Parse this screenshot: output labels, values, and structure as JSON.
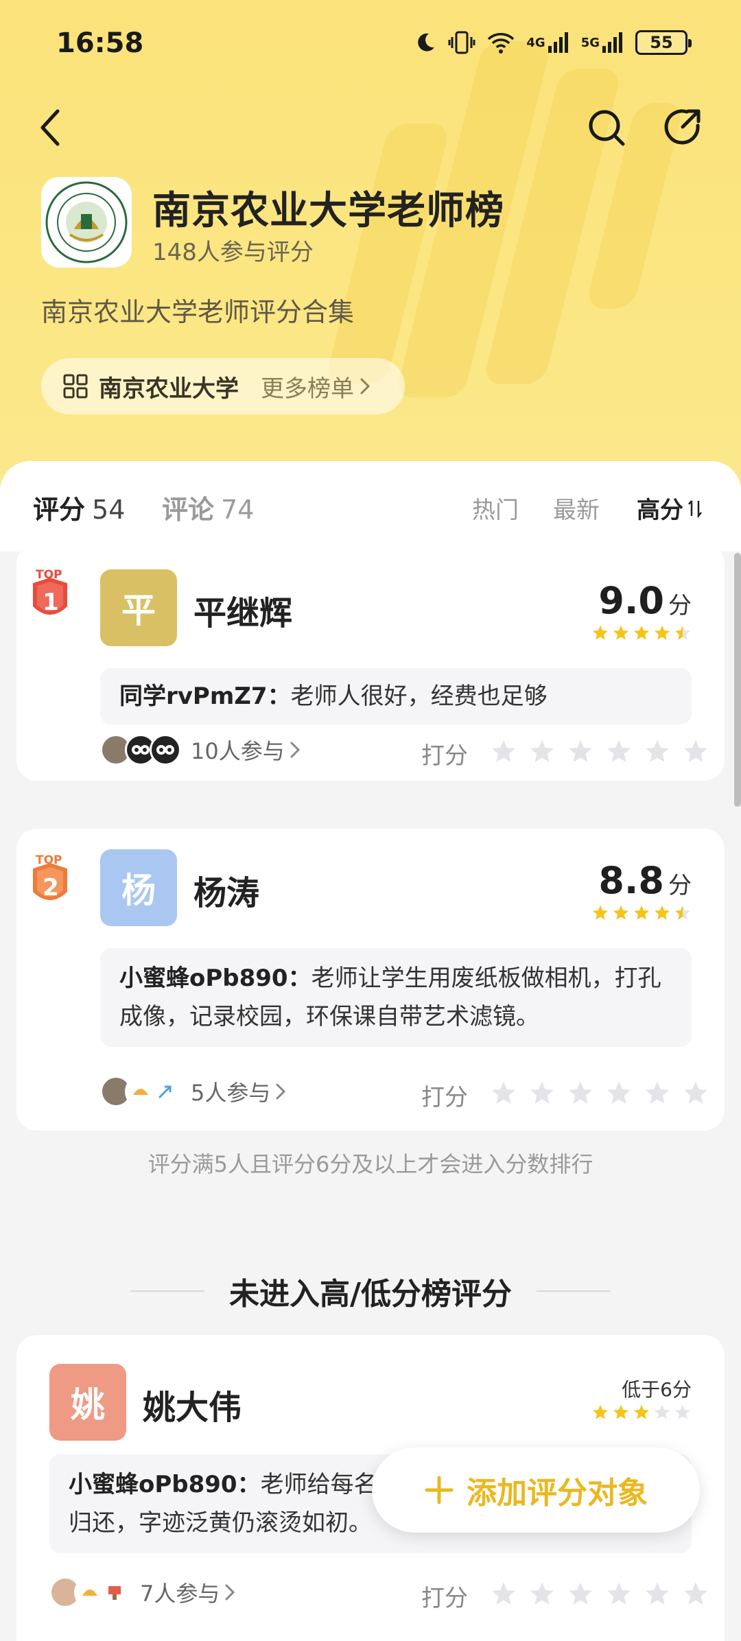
{
  "status_bar": {
    "time": "16:58",
    "network_a": "4G",
    "network_b": "5G",
    "battery": "55"
  },
  "header": {
    "title": "南京农业大学老师榜",
    "participants": "148人参与评分",
    "description": "南京农业大学老师评分合集",
    "school_name": "南京农业大学",
    "more_lists": "更多榜单"
  },
  "tabs": {
    "score_label": "评分",
    "score_count": "54",
    "comment_label": "评论",
    "comment_count": "74",
    "sort_hot": "热门",
    "sort_new": "最新",
    "sort_high": "高分"
  },
  "ranked": [
    {
      "rank": "1",
      "top_label": "TOP",
      "avatar_char": "平",
      "name": "平继辉",
      "score": "9.0",
      "score_unit": "分",
      "stars": 4.5,
      "comment_user": "同学rvPmZ7：",
      "comment_text": "老师人很好，经费也足够",
      "participants": "10人参与",
      "rate_label": "打分",
      "avatar_color": "#d9c064"
    },
    {
      "rank": "2",
      "top_label": "TOP",
      "avatar_char": "杨",
      "name": "杨涛",
      "score": "8.8",
      "score_unit": "分",
      "stars": 4.5,
      "comment_user": "小蜜蜂oPb890：",
      "comment_text": "老师让学生用废纸板做相机，打孔成像，记录校园，环保课自带艺术滤镜。",
      "participants": "5人参与",
      "rate_label": "打分",
      "avatar_color": "#a9c7f0"
    }
  ],
  "rule_note": "评分满5人且评分6分及以上才会进入分数排行",
  "section_title": "未进入高/低分榜评分",
  "unranked": [
    {
      "avatar_char": "姚",
      "name": "姚大伟",
      "low_text": "低于6分",
      "stars": 3,
      "comment_user": "小蜜蜂oPb890：",
      "comment_text": "老师给每名",
      "comment_text_line2": "归还，字迹泛黄仍滚烫如初。",
      "participants": "7人参与",
      "rate_label": "打分",
      "avatar_color": "#ee9a84"
    }
  ],
  "fab": {
    "label": "添加评分对象",
    "plus": "+"
  },
  "colors": {
    "accent": "#eab81f",
    "star": "#f5c419",
    "star_empty": "#e4e4e8",
    "header_bg": "#fbe27a"
  }
}
